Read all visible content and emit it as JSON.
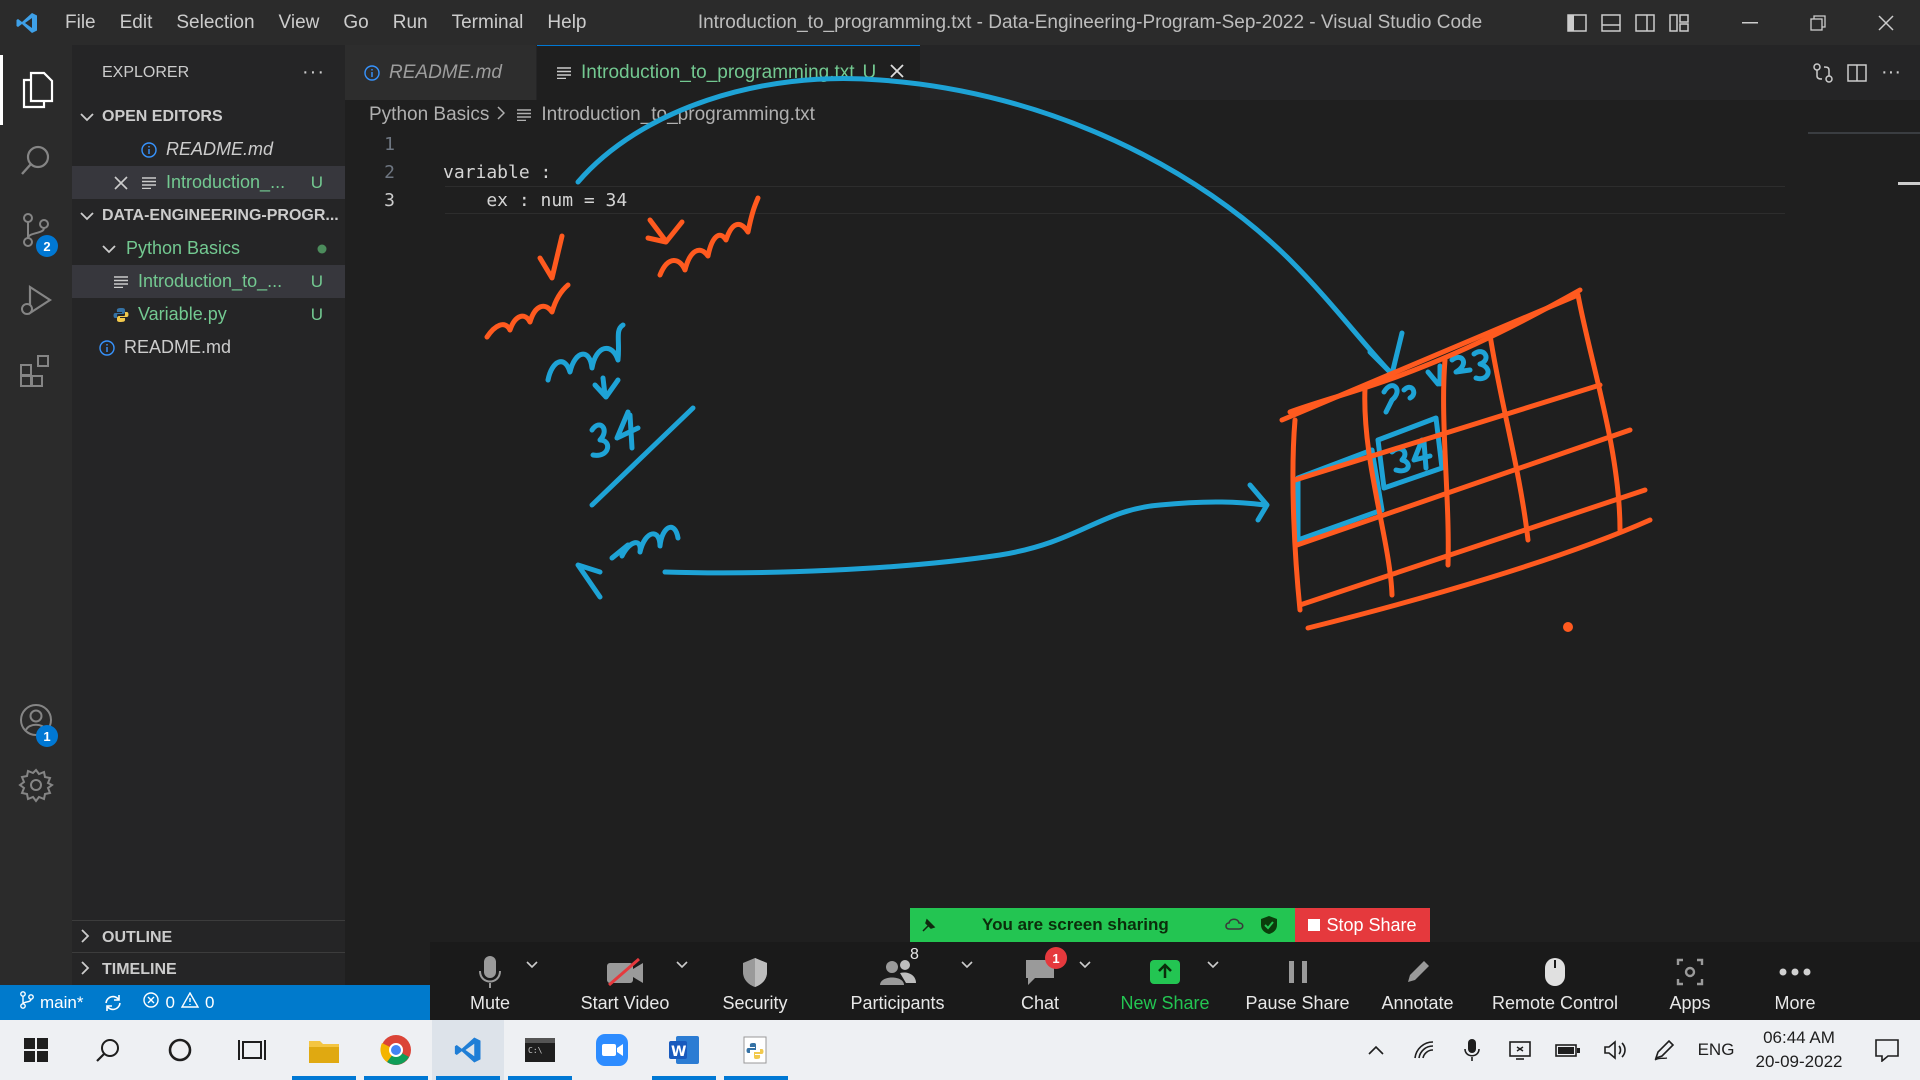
{
  "window": {
    "title": "Introduction_to_programming.txt - Data-Engineering-Program-Sep-2022 - Visual Studio Code",
    "menu": [
      "File",
      "Edit",
      "Selection",
      "View",
      "Go",
      "Run",
      "Terminal",
      "Help"
    ]
  },
  "activity_bar": {
    "source_control_badge": "2",
    "accounts_badge": "1"
  },
  "explorer": {
    "header": "EXPLORER",
    "more": "···",
    "open_editors": {
      "title": "OPEN EDITORS",
      "items": [
        {
          "label": "README.md",
          "status": ""
        },
        {
          "label": "Introduction_...",
          "status": "U"
        }
      ]
    },
    "workspace": {
      "title": "DATA-ENGINEERING-PROGR...",
      "folder": "Python Basics",
      "files": [
        {
          "label": "Introduction_to_...",
          "status": "U"
        },
        {
          "label": "Variable.py",
          "status": "U"
        }
      ],
      "root_file": "README.md"
    },
    "outline": "OUTLINE",
    "timeline": "TIMELINE"
  },
  "tabs": [
    {
      "label": "README.md",
      "active": false
    },
    {
      "label": "Introduction_to_programming.txt",
      "status": "U",
      "active": true
    }
  ],
  "breadcrumb": [
    "Python Basics",
    "Introduction_to_programming.txt"
  ],
  "code": {
    "lines": [
      {
        "n": "1",
        "text": ""
      },
      {
        "n": "2",
        "text": "variable :"
      },
      {
        "n": "3",
        "text": "    ex : num = 34"
      }
    ]
  },
  "status_bar": {
    "branch": "main*",
    "errors": "0",
    "warnings": "0"
  },
  "zoom": {
    "banner": "You are screen sharing",
    "stop_share": "Stop Share",
    "participants_count": "8",
    "chat_badge": "1",
    "buttons": [
      "Mute",
      "Start Video",
      "Security",
      "Participants",
      "Chat",
      "New Share",
      "Pause Share",
      "Annotate",
      "Remote Control",
      "Apps",
      "More"
    ],
    "new_share_color": "#23c552"
  },
  "taskbar": {
    "language": "ENG",
    "time": "06:44 AM",
    "date": "20-09-2022"
  },
  "colors": {
    "accent": "#007acc",
    "untracked": "#73c991",
    "ink_blue": "#1ea3d6",
    "ink_orange": "#ff5a1f"
  }
}
